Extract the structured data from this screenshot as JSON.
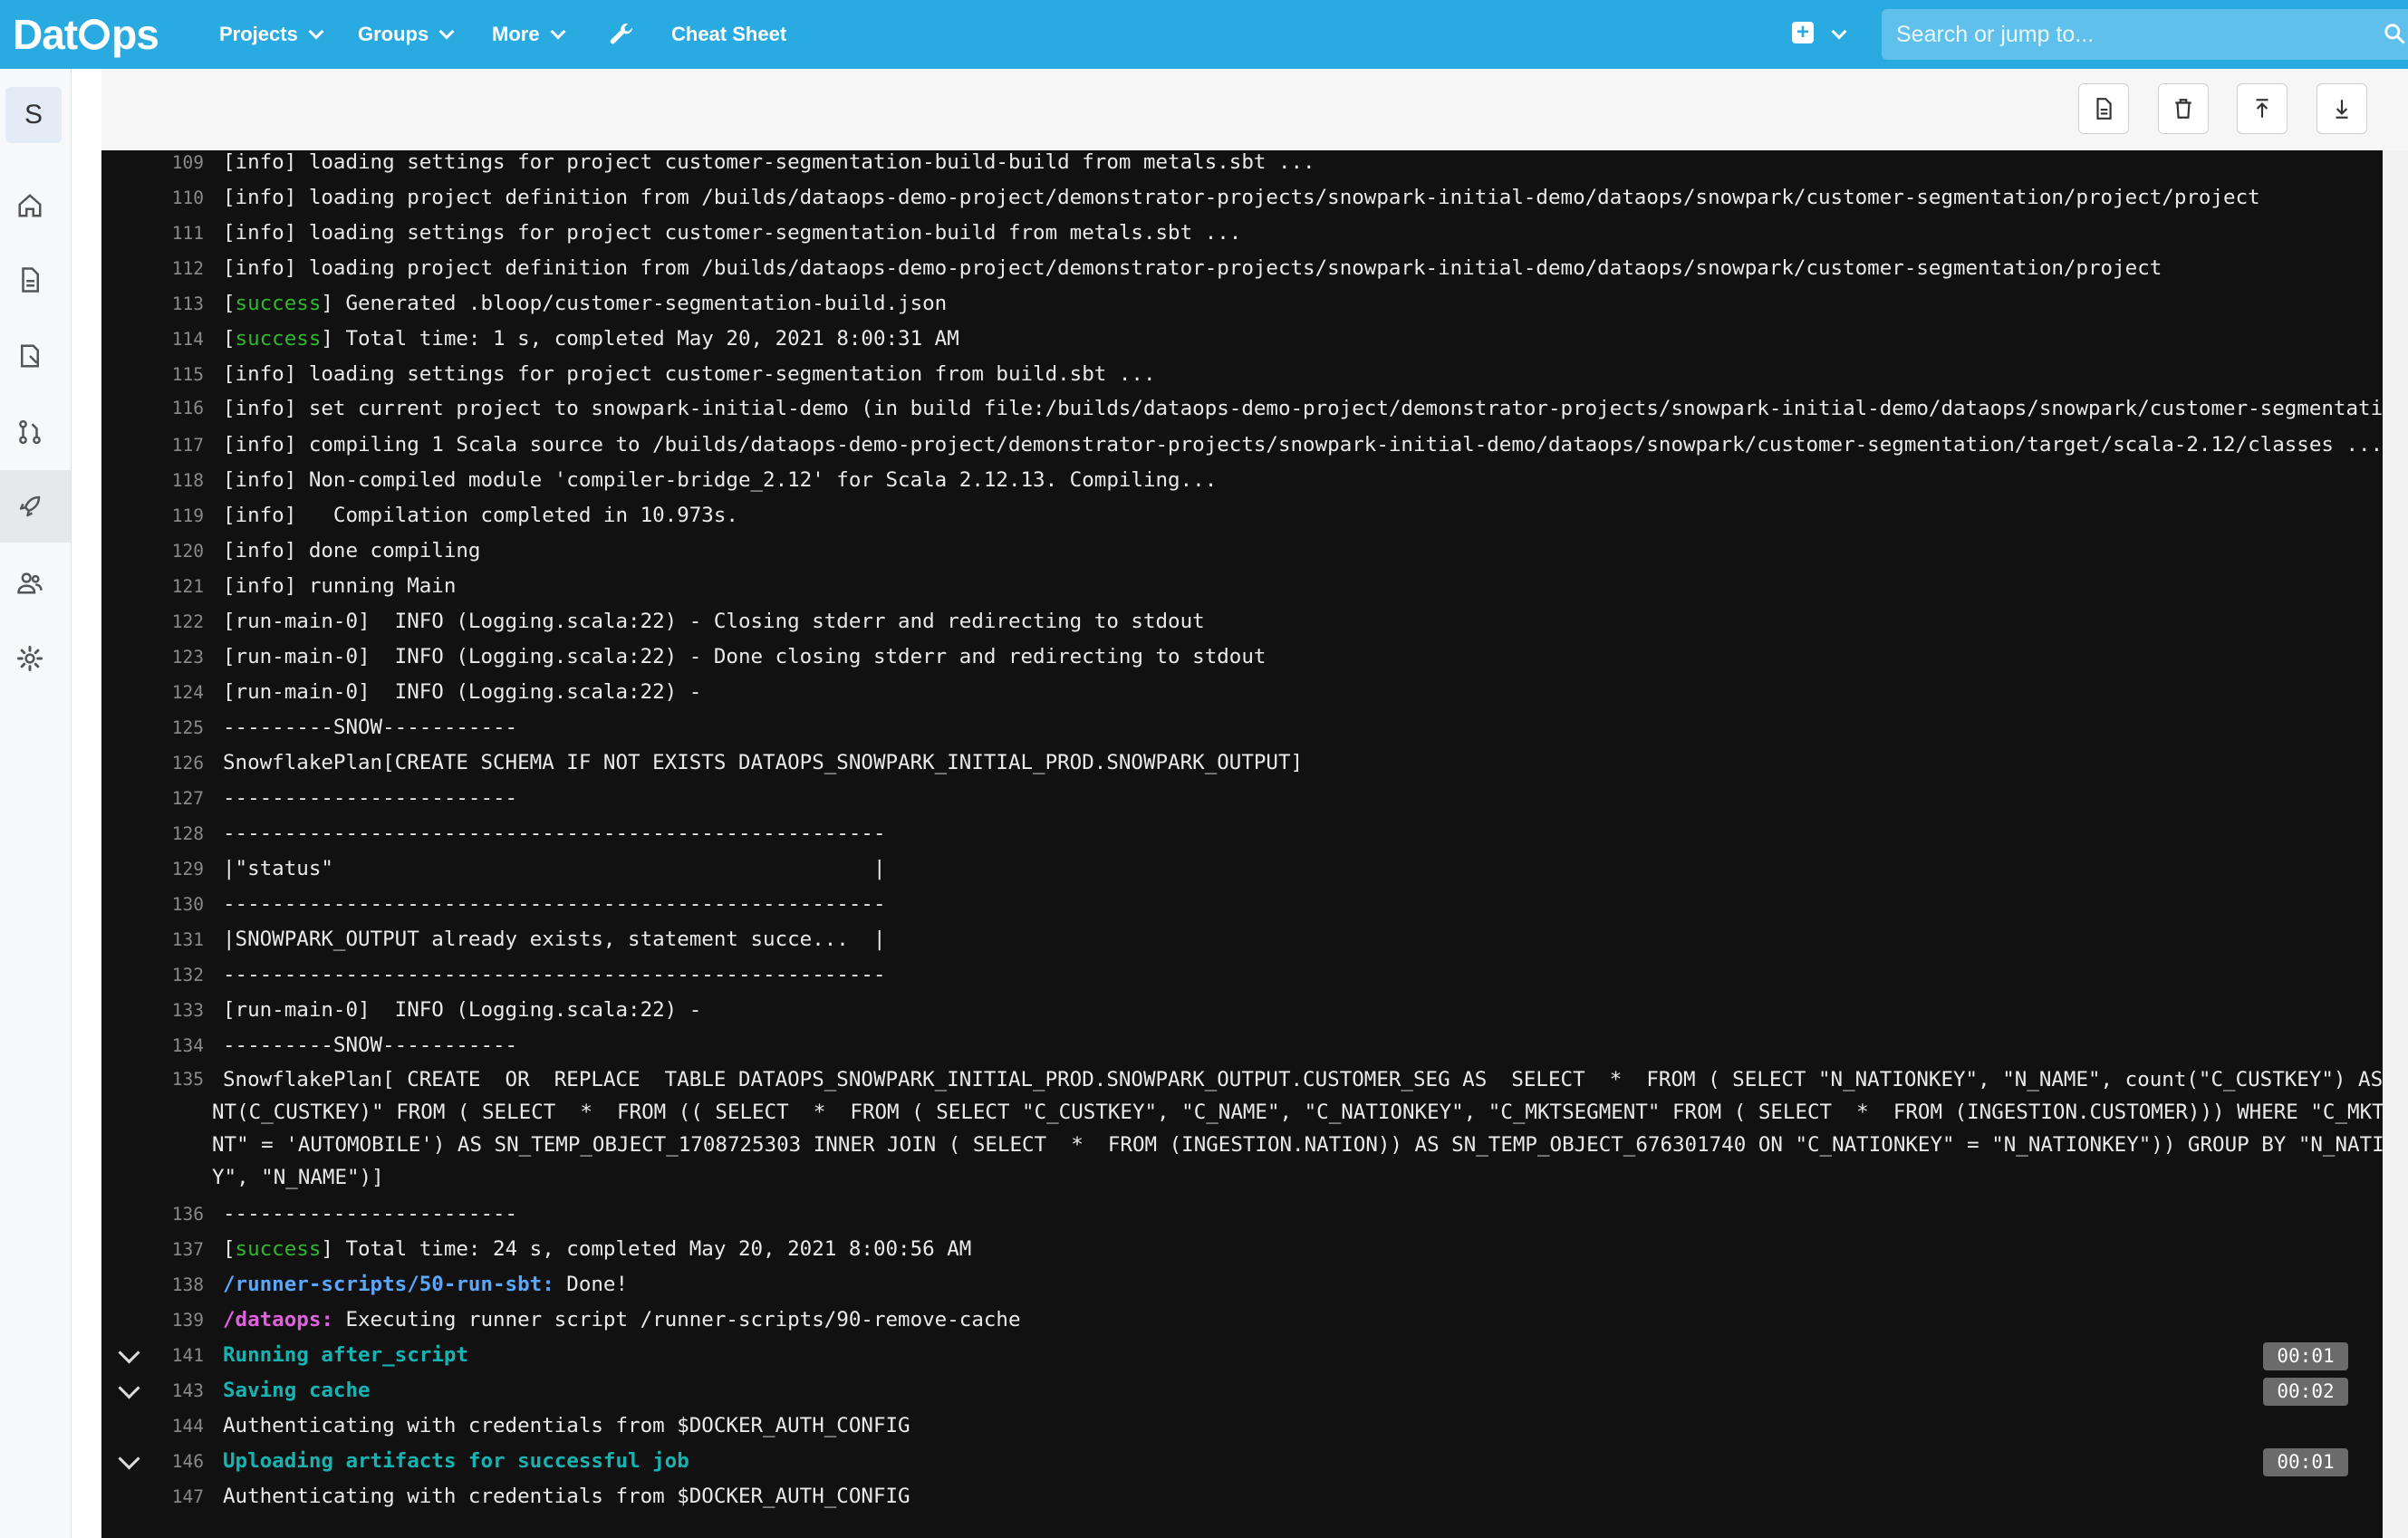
{
  "nav": {
    "logo_left": "Dat",
    "logo_right": "ps",
    "projects": "Projects",
    "groups": "Groups",
    "more": "More",
    "cheat_sheet": "Cheat Sheet",
    "search_placeholder": "Search or jump to..."
  },
  "sidebar": {
    "avatar_letter": "S",
    "icons": [
      "home-icon",
      "document-icon",
      "issues-icon",
      "merge-request-icon",
      "rocket-icon",
      "members-icon",
      "settings-icon"
    ]
  },
  "log_lines": [
    {
      "n": "109",
      "parts": [
        {
          "t": "[info] loading settings for project customer-segmentation-build-build from metals.sbt ..."
        }
      ]
    },
    {
      "n": "110",
      "parts": [
        {
          "t": "[info] loading project definition from /builds/dataops-demo-project/demonstrator-projects/snowpark-initial-demo/dataops/snowpark/customer-segmentation/project/project"
        }
      ]
    },
    {
      "n": "111",
      "parts": [
        {
          "t": "[info] loading settings for project customer-segmentation-build from metals.sbt ..."
        }
      ]
    },
    {
      "n": "112",
      "parts": [
        {
          "t": "[info] loading project definition from /builds/dataops-demo-project/demonstrator-projects/snowpark-initial-demo/dataops/snowpark/customer-segmentation/project"
        }
      ]
    },
    {
      "n": "113",
      "parts": [
        {
          "t": "["
        },
        {
          "t": "success",
          "c": "green"
        },
        {
          "t": "] Generated .bloop/customer-segmentation-build.json"
        }
      ]
    },
    {
      "n": "114",
      "parts": [
        {
          "t": "["
        },
        {
          "t": "success",
          "c": "green"
        },
        {
          "t": "] Total time: 1 s, completed May 20, 2021 8:00:31 AM"
        }
      ]
    },
    {
      "n": "115",
      "parts": [
        {
          "t": "[info] loading settings for project customer-segmentation from build.sbt ..."
        }
      ]
    },
    {
      "n": "116",
      "wrap": true,
      "parts": [
        {
          "t": "[info] set current project to snowpark-initial-demo (in build file:/builds/dataops-demo-project/demonstrator-projects/snowpark-initial-demo/dataops/snowpark/customer-segmentation/)"
        }
      ]
    },
    {
      "n": "117",
      "parts": [
        {
          "t": "[info] compiling 1 Scala source to /builds/dataops-demo-project/demonstrator-projects/snowpark-initial-demo/dataops/snowpark/customer-segmentation/target/scala-2.12/classes ..."
        }
      ]
    },
    {
      "n": "118",
      "parts": [
        {
          "t": "[info] Non-compiled module 'compiler-bridge_2.12' for Scala 2.12.13. Compiling..."
        }
      ]
    },
    {
      "n": "119",
      "parts": [
        {
          "t": "[info]   Compilation completed in 10.973s."
        }
      ]
    },
    {
      "n": "120",
      "parts": [
        {
          "t": "[info] done compiling"
        }
      ]
    },
    {
      "n": "121",
      "parts": [
        {
          "t": "[info] running Main"
        }
      ]
    },
    {
      "n": "122",
      "parts": [
        {
          "t": "[run-main-0]  INFO (Logging.scala:22) - Closing stderr and redirecting to stdout"
        }
      ]
    },
    {
      "n": "123",
      "parts": [
        {
          "t": "[run-main-0]  INFO (Logging.scala:22) - Done closing stderr and redirecting to stdout"
        }
      ]
    },
    {
      "n": "124",
      "parts": [
        {
          "t": "[run-main-0]  INFO (Logging.scala:22) -"
        }
      ]
    },
    {
      "n": "125",
      "parts": [
        {
          "t": "---------SNOW-----------"
        }
      ]
    },
    {
      "n": "126",
      "parts": [
        {
          "t": "SnowflakePlan[CREATE SCHEMA IF NOT EXISTS DATAOPS_SNOWPARK_INITIAL_PROD.SNOWPARK_OUTPUT]"
        }
      ]
    },
    {
      "n": "127",
      "parts": [
        {
          "t": "------------------------"
        }
      ]
    },
    {
      "n": "128",
      "parts": [
        {
          "t": "------------------------------------------------------"
        }
      ]
    },
    {
      "n": "129",
      "parts": [
        {
          "t": "|\"status\"                                            |"
        }
      ]
    },
    {
      "n": "130",
      "parts": [
        {
          "t": "------------------------------------------------------"
        }
      ]
    },
    {
      "n": "131",
      "parts": [
        {
          "t": "|SNOWPARK_OUTPUT already exists, statement succe...  |"
        }
      ]
    },
    {
      "n": "132",
      "parts": [
        {
          "t": "------------------------------------------------------"
        }
      ]
    },
    {
      "n": "133",
      "parts": [
        {
          "t": "[run-main-0]  INFO (Logging.scala:22) -"
        }
      ]
    },
    {
      "n": "134",
      "parts": [
        {
          "t": "---------SNOW-----------"
        }
      ]
    },
    {
      "n": "135",
      "wrap": true,
      "parts": [
        {
          "t": "SnowflakePlan[ CREATE  OR  REPLACE  TABLE DATAOPS_SNOWPARK_INITIAL_PROD.SNOWPARK_OUTPUT.CUSTOMER_SEG AS  SELECT  *  FROM ( SELECT \"N_NATIONKEY\", \"N_NAME\", count(\"C_CUSTKEY\") AS \"COUNT(C_CUSTKEY)\" FROM ( SELECT  *  FROM (( SELECT  *  FROM ( SELECT \"C_CUSTKEY\", \"C_NAME\", \"C_NATIONKEY\", \"C_MKTSEGMENT\" FROM ( SELECT  *  FROM (INGESTION.CUSTOMER))) WHERE \"C_MKTSEGMENT\" = 'AUTOMOBILE') AS SN_TEMP_OBJECT_1708725303 INNER JOIN ( SELECT  *  FROM (INGESTION.NATION)) AS SN_TEMP_OBJECT_676301740 ON \"C_NATIONKEY\" = \"N_NATIONKEY\")) GROUP BY \"N_NATIONKEY\", \"N_NAME\")]"
        }
      ]
    },
    {
      "n": "136",
      "parts": [
        {
          "t": "------------------------"
        }
      ]
    },
    {
      "n": "137",
      "parts": [
        {
          "t": "["
        },
        {
          "t": "success",
          "c": "green"
        },
        {
          "t": "] Total time: 24 s, completed May 20, 2021 8:00:56 AM"
        }
      ]
    },
    {
      "n": "138",
      "parts": [
        {
          "t": "/runner-scripts/50-run-sbt:",
          "c": "blue"
        },
        {
          "t": " Done!"
        }
      ]
    },
    {
      "n": "139",
      "parts": [
        {
          "t": "/dataops:",
          "c": "magenta"
        },
        {
          "t": " Executing runner script /runner-scripts/90-remove-cache"
        }
      ]
    },
    {
      "n": "141",
      "toggle": true,
      "duration": "00:01",
      "parts": [
        {
          "t": "Running after_script",
          "c": "teal"
        }
      ]
    },
    {
      "n": "143",
      "toggle": true,
      "duration": "00:02",
      "parts": [
        {
          "t": "Saving cache",
          "c": "teal"
        }
      ]
    },
    {
      "n": "144",
      "parts": [
        {
          "t": "Authenticating with credentials from $DOCKER_AUTH_CONFIG"
        }
      ]
    },
    {
      "n": "146",
      "toggle": true,
      "duration": "00:01",
      "parts": [
        {
          "t": "Uploading artifacts for successful job",
          "c": "teal"
        }
      ]
    },
    {
      "n": "147",
      "parts": [
        {
          "t": "Authenticating with credentials from $DOCKER_AUTH_CONFIG"
        }
      ]
    }
  ]
}
